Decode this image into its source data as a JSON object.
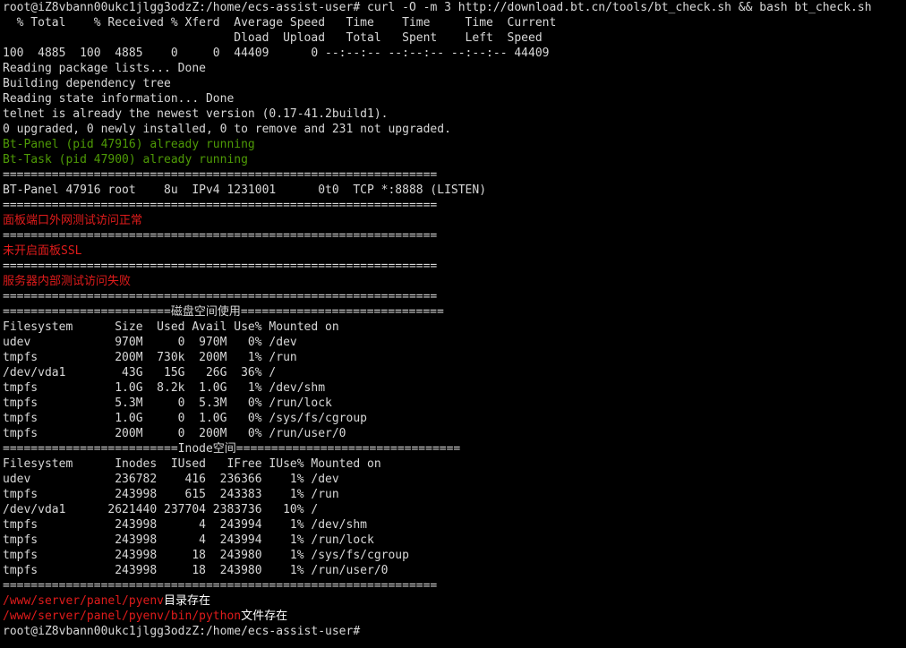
{
  "colors": {
    "background": "#000000",
    "default_text": "#d8d8d8",
    "success_text": "#4e9a06",
    "error_text": "#e01b1b"
  },
  "terminal": {
    "prompt": "root@iZ8vbann00ukc1jlgg3odzZ:/home/ecs-assist-user#",
    "command": " curl -O -m 3 http://download.bt.cn/tools/bt_check.sh && bash bt_check.sh",
    "curl_header1": "  % Total    % Received % Xferd  Average Speed   Time    Time     Time  Current",
    "curl_header2": "                                 Dload  Upload   Total   Spent    Left  Speed",
    "curl_progress": "100  4885  100  4885    0     0  44409      0 --:--:-- --:--:-- --:--:-- 44409",
    "apt_lines": [
      "Reading package lists... Done",
      "Building dependency tree",
      "Reading state information... Done",
      "telnet is already the newest version (0.17-41.2build1).",
      "0 upgraded, 0 newly installed, 0 to remove and 231 not upgraded."
    ],
    "status_lines": [
      "Bt-Panel (pid 47916) already running",
      "Bt-Task (pid 47900) already running"
    ],
    "separator": "==============================================================",
    "lsof_line": "BT-Panel 47916 root    8u  IPv4 1231001      0t0  TCP *:8888 (LISTEN)",
    "check_external": "面板端口外网测试访问正常",
    "check_ssl": "未开启面板SSL",
    "check_internal": "服务器内部测试访问失败",
    "disk_title": "========================磁盘空间使用=============================",
    "disk_header": "Filesystem      Size  Used Avail Use% Mounted on",
    "disk_rows": [
      "udev            970M     0  970M   0% /dev",
      "tmpfs           200M  730k  200M   1% /run",
      "/dev/vda1        43G   15G   26G  36% /",
      "tmpfs           1.0G  8.2k  1.0G   1% /dev/shm",
      "tmpfs           5.3M     0  5.3M   0% /run/lock",
      "tmpfs           1.0G     0  1.0G   0% /sys/fs/cgroup",
      "tmpfs           200M     0  200M   0% /run/user/0"
    ],
    "inode_title": "=========================Inode空间================================",
    "inode_header": "Filesystem      Inodes  IUsed   IFree IUse% Mounted on",
    "inode_rows": [
      "udev            236782    416  236366    1% /dev",
      "tmpfs           243998    615  243383    1% /run",
      "/dev/vda1      2621440 237704 2383736   10% /",
      "tmpfs           243998      4  243994    1% /dev/shm",
      "tmpfs           243998      4  243994    1% /run/lock",
      "tmpfs           243998     18  243980    1% /sys/fs/cgroup",
      "tmpfs           243998     18  243980    1% /run/user/0"
    ],
    "pyenv_dir_path": "/www/server/panel/pyenv",
    "pyenv_dir_msg": "目录存在",
    "python_path": "/www/server/panel/pyenv/bin/python",
    "python_msg": "文件存在",
    "final_prompt": "root@iZ8vbann00ukc1jlgg3odzZ:/home/ecs-assist-user#"
  }
}
